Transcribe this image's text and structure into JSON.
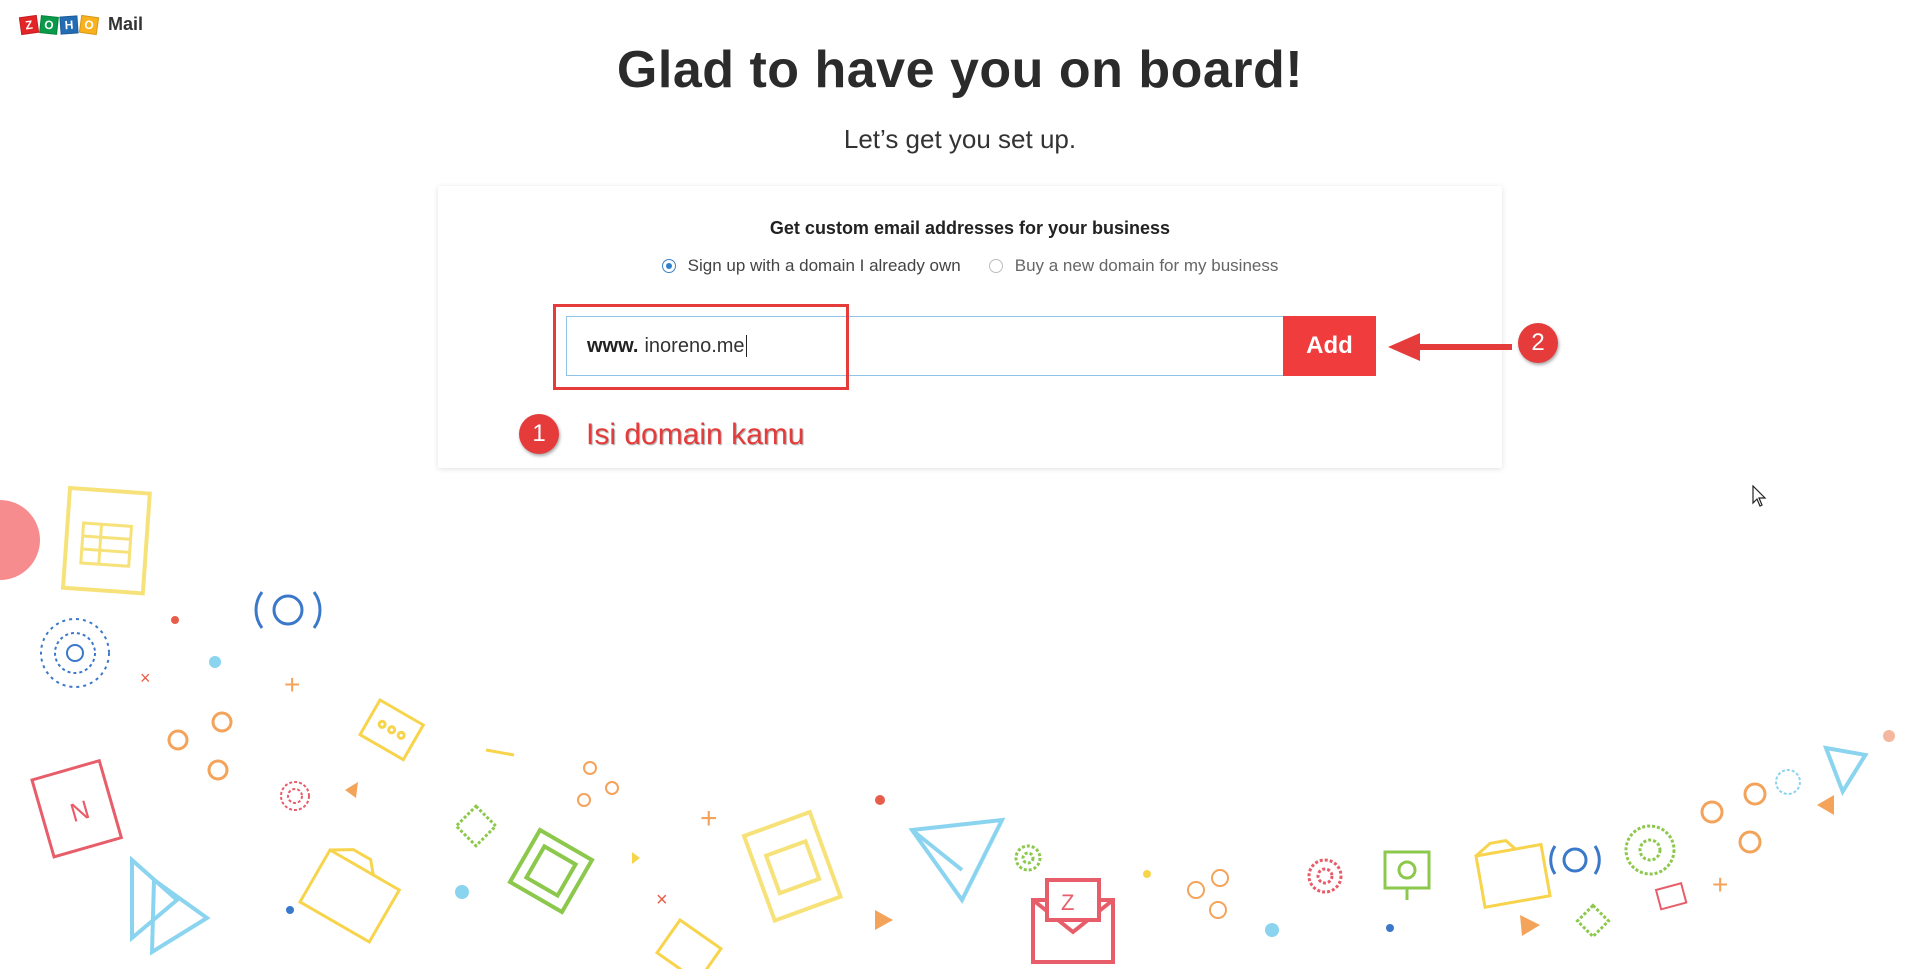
{
  "logo": {
    "letters": [
      "Z",
      "O",
      "H",
      "O"
    ],
    "product": "Mail"
  },
  "headline": "Glad to have you on board!",
  "subheadline": "Let’s get you set up.",
  "card": {
    "title": "Get custom email addresses for your business",
    "radio_options": [
      {
        "label": "Sign up with a domain I already own",
        "selected": true
      },
      {
        "label": "Buy a new domain for my business",
        "selected": false
      }
    ],
    "domain_prefix": "www.",
    "domain_value": "inoreno.me",
    "add_label": "Add"
  },
  "annotations": {
    "step1_number": "1",
    "step1_text": "Isi domain kamu",
    "step2_number": "2",
    "color": "#e53b3b"
  },
  "colors": {
    "accent": "#f03c3c",
    "radio_selected": "#2f80c9",
    "input_border": "#8fc3e8"
  }
}
